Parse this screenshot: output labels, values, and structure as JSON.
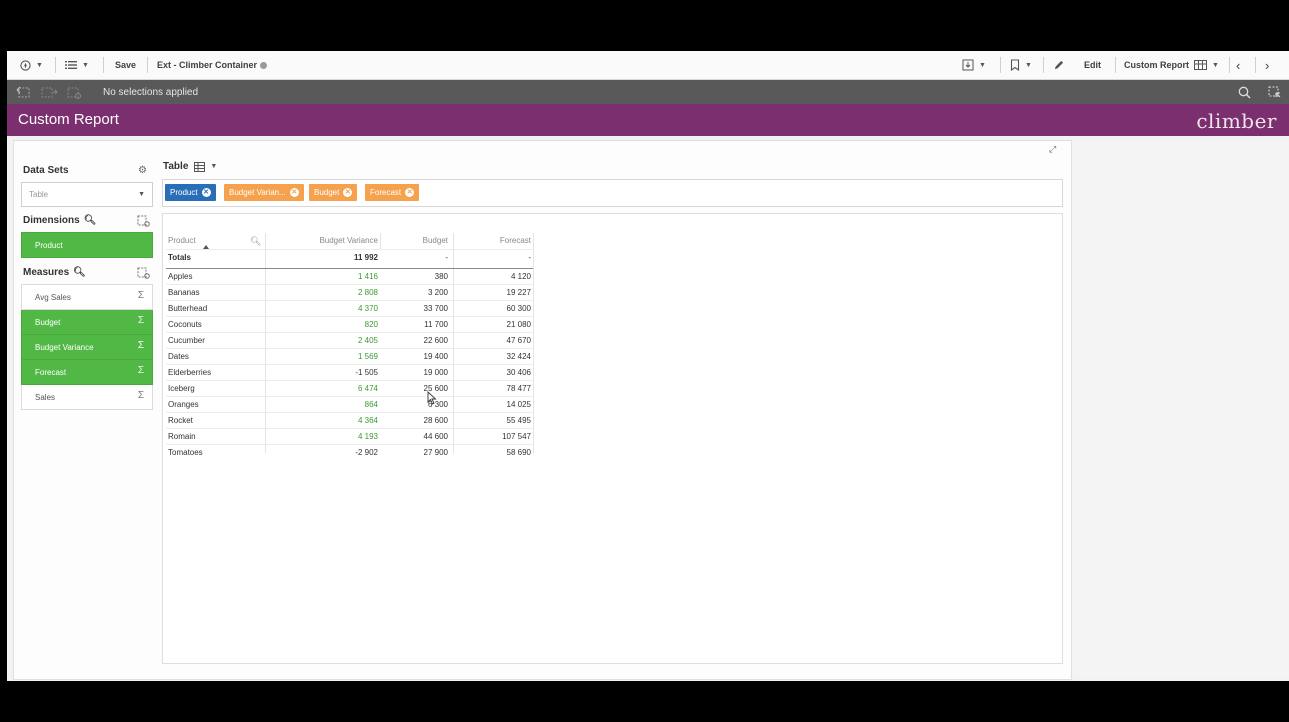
{
  "toolbar": {
    "save_label": "Save",
    "app_name": "Ext - Climber Container",
    "edit_label": "Edit",
    "sheet_name": "Custom Report"
  },
  "selections": {
    "status": "No selections applied"
  },
  "titlebar": {
    "title": "Custom Report",
    "logo_text": "climber"
  },
  "left_panel": {
    "datasets_title": "Data Sets",
    "dataset_value": "Table",
    "dimensions_title": "Dimensions",
    "dimensions": [
      {
        "label": "Product",
        "active": true
      }
    ],
    "measures_title": "Measures",
    "measures": [
      {
        "label": "Avg Sales",
        "active": false
      },
      {
        "label": "Budget",
        "active": true
      },
      {
        "label": "Budget Variance",
        "active": true
      },
      {
        "label": "Forecast",
        "active": true
      },
      {
        "label": "Sales",
        "active": false
      }
    ]
  },
  "visualization": {
    "type_label": "Table",
    "chips": [
      {
        "label": "Product",
        "color": "#2b6eb8"
      },
      {
        "label": "Budget Varian...",
        "color": "#f5a14d"
      },
      {
        "label": "Budget",
        "color": "#f5a14d"
      },
      {
        "label": "Forecast",
        "color": "#f5a14d"
      }
    ]
  },
  "table": {
    "columns": [
      "Product",
      "Budget Variance",
      "Budget",
      "Forecast"
    ],
    "totals": {
      "label": "Totals",
      "budget_variance": "11 992",
      "budget": "-",
      "forecast": "-"
    },
    "rows": [
      {
        "product": "Apples",
        "budget_variance": "1 416",
        "budget": "380",
        "forecast": "4 120"
      },
      {
        "product": "Bananas",
        "budget_variance": "2 808",
        "budget": "3 200",
        "forecast": "19 227"
      },
      {
        "product": "Butterhead",
        "budget_variance": "4 370",
        "budget": "33 700",
        "forecast": "60 300"
      },
      {
        "product": "Coconuts",
        "budget_variance": "820",
        "budget": "11 700",
        "forecast": "21 080"
      },
      {
        "product": "Cucumber",
        "budget_variance": "2 405",
        "budget": "22 600",
        "forecast": "47 670"
      },
      {
        "product": "Dates",
        "budget_variance": "1 569",
        "budget": "19 400",
        "forecast": "32 424"
      },
      {
        "product": "Elderberries",
        "budget_variance": "-1 505",
        "budget": "19 000",
        "forecast": "30 406"
      },
      {
        "product": "Iceberg",
        "budget_variance": "6 474",
        "budget": "25 600",
        "forecast": "78 477"
      },
      {
        "product": "Oranges",
        "budget_variance": "864",
        "budget": "6 300",
        "forecast": "14 025"
      },
      {
        "product": "Rocket",
        "budget_variance": "4 364",
        "budget": "28 600",
        "forecast": "55 495"
      },
      {
        "product": "Romain",
        "budget_variance": "4 193",
        "budget": "44 600",
        "forecast": "107 547"
      },
      {
        "product": "Tomatoes",
        "budget_variance": "-2 902",
        "budget": "27 900",
        "forecast": "58 690"
      }
    ]
  }
}
